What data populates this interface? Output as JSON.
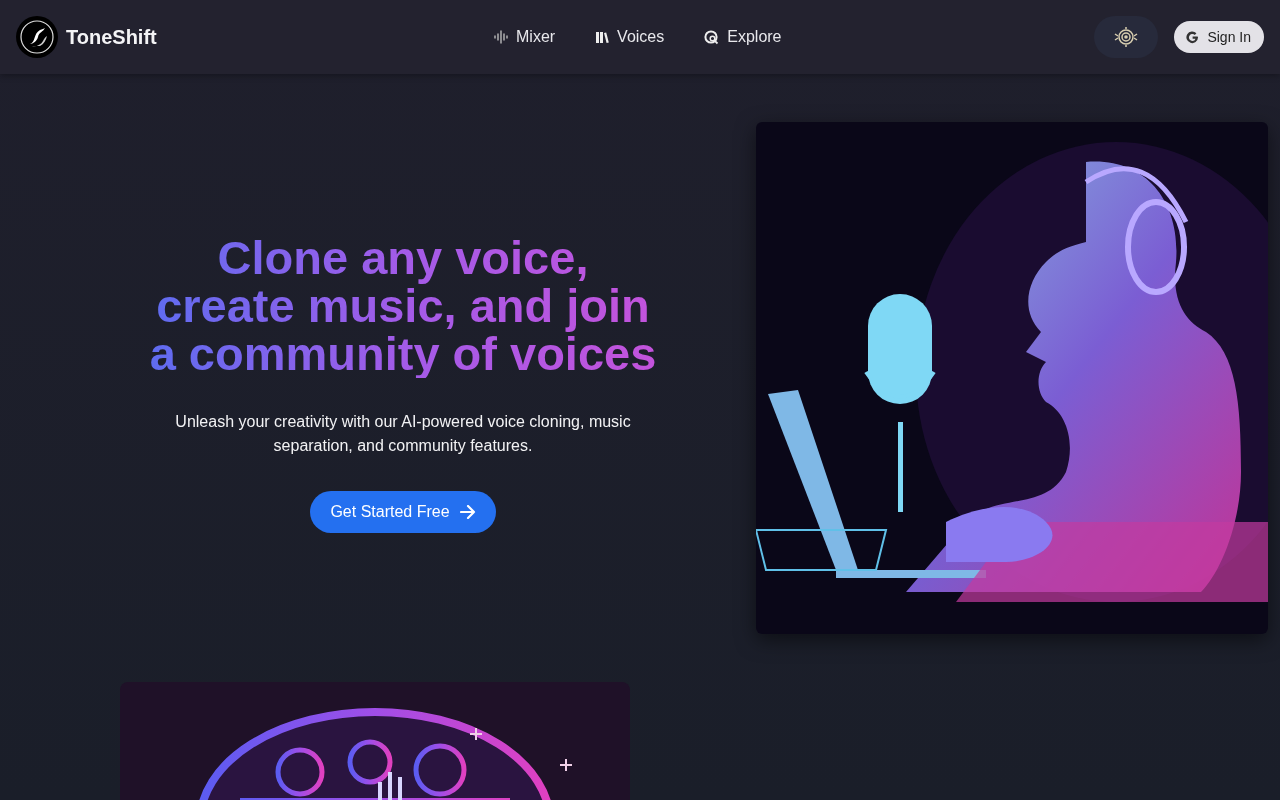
{
  "header": {
    "brand": "ToneShift",
    "nav": [
      {
        "label": "Mixer",
        "kind": "wave"
      },
      {
        "label": "Voices",
        "kind": "books"
      },
      {
        "label": "Explore",
        "kind": "globe"
      }
    ],
    "sign_in": "Sign In"
  },
  "hero": {
    "title": "Clone any voice,\ncreate music, and join\na community of voices",
    "subtitle": "Unleash your creativity with our AI-powered voice cloning, music\nseparation, and community features.",
    "cta": "Get Started Free"
  }
}
